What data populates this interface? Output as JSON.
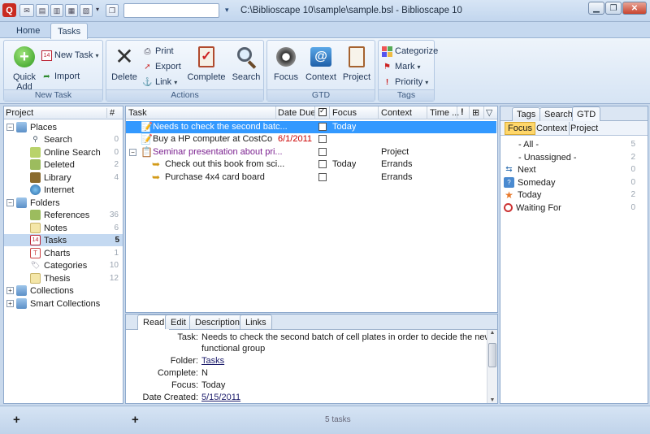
{
  "window": {
    "title": "C:\\Biblioscape 10\\sample\\sample.bsl - Biblioscape 10",
    "app_icon": "Q"
  },
  "ribbon": {
    "tabs": [
      {
        "label": "Home"
      },
      {
        "label": "Tasks"
      }
    ],
    "groups": {
      "new_task": {
        "label": "New Task",
        "quick_add": "Quick\nAdd",
        "quick_add_l1": "Quick",
        "quick_add_l2": "Add",
        "new_task": "New Task",
        "import": "Import"
      },
      "actions": {
        "label": "Actions",
        "delete": "Delete",
        "print": "Print",
        "export": "Export",
        "link": "Link",
        "complete": "Complete",
        "search": "Search"
      },
      "gtd": {
        "label": "GTD",
        "focus": "Focus",
        "context": "Context",
        "project": "Project"
      },
      "tags": {
        "label": "Tags",
        "categorize": "Categorize",
        "mark": "Mark",
        "priority": "Priority"
      }
    }
  },
  "left_pane": {
    "header": {
      "project": "Project",
      "count": "#"
    },
    "tree": [
      {
        "label": "Places",
        "count": ""
      },
      {
        "label": "Search",
        "count": "0"
      },
      {
        "label": "Online Search",
        "count": "0"
      },
      {
        "label": "Deleted",
        "count": "2"
      },
      {
        "label": "Library",
        "count": "4"
      },
      {
        "label": "Internet",
        "count": ""
      },
      {
        "label": "Folders",
        "count": ""
      },
      {
        "label": "References",
        "count": "36"
      },
      {
        "label": "Notes",
        "count": "6"
      },
      {
        "label": "Tasks",
        "count": "5"
      },
      {
        "label": "Charts",
        "count": "1"
      },
      {
        "label": "Categories",
        "count": "10"
      },
      {
        "label": "Thesis",
        "count": "12"
      },
      {
        "label": "Collections",
        "count": ""
      },
      {
        "label": "Smart Collections",
        "count": ""
      }
    ]
  },
  "task_grid": {
    "columns": {
      "task": "Task",
      "date_due": "Date Due",
      "focus": "Focus",
      "context": "Context",
      "time": "Time ..."
    },
    "rows": [
      {
        "task": "Needs to check the second batc...",
        "date_due": "",
        "focus": "Today",
        "context": ""
      },
      {
        "task": "Buy a HP computer at CostCo",
        "date_due": "6/1/2011",
        "focus": "",
        "context": ""
      },
      {
        "task": "Seminar presentation about pri...",
        "date_due": "",
        "focus": "",
        "context": "Project"
      },
      {
        "task": "Check out this book from sci...",
        "date_due": "",
        "focus": "Today",
        "context": "Errands"
      },
      {
        "task": "Purchase 4x4 card board",
        "date_due": "",
        "focus": "",
        "context": "Errands"
      }
    ]
  },
  "detail": {
    "tabs": [
      {
        "label": "Read"
      },
      {
        "label": "Edit"
      },
      {
        "label": "Description"
      },
      {
        "label": "Links"
      }
    ],
    "fields": {
      "task_label": "Task:",
      "task_value_l1": "Needs to check the second batch of cell plates in order to decide the new",
      "task_value_l2": "functional group",
      "folder_label": "Folder:",
      "folder_value": "Tasks",
      "complete_label": "Complete:",
      "complete_value": "N",
      "focus_label": "Focus:",
      "focus_value": "Today",
      "date_created_label": "Date Created:",
      "date_created_value": "5/15/2011"
    }
  },
  "right_pane": {
    "tabs": [
      {
        "label": "Tags"
      },
      {
        "label": "Search"
      },
      {
        "label": "GTD"
      }
    ],
    "subtabs": [
      {
        "label": "Focus"
      },
      {
        "label": "Context"
      },
      {
        "label": "Project"
      }
    ],
    "items": [
      {
        "label": "- All -",
        "count": "5"
      },
      {
        "label": "- Unassigned -",
        "count": "2"
      },
      {
        "label": "Next",
        "count": "0"
      },
      {
        "label": "Someday",
        "count": "0"
      },
      {
        "label": "Today",
        "count": "2"
      },
      {
        "label": "Waiting For",
        "count": "0"
      }
    ]
  },
  "status": {
    "left_add": "+",
    "mid_add": "+",
    "count_text": "5  tasks"
  },
  "colors": {
    "accent": "#3399ff",
    "selected_row": "#3399ff",
    "due_red": "#cc0000",
    "purple_text": "#7a1f8f"
  }
}
